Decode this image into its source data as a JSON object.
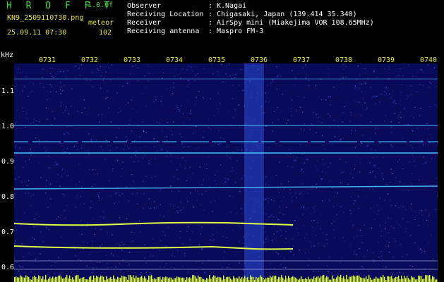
{
  "header": {
    "app_title": "H R O F F T",
    "version": "1.0.0f",
    "file_name": "KN9_2509110730.png",
    "detect_label": "meteor",
    "datetime": "25.09.11 07:30",
    "detect_count": "102"
  },
  "info": [
    {
      "key": "Observer",
      "sep": ":",
      "value": "K.Nagai"
    },
    {
      "key": "Receiving Location",
      "sep": ":",
      "value": "Chigasaki, Japan (139.414 35.340)"
    },
    {
      "key": "Receiver",
      "sep": ":",
      "value": "AirSpy mini (Miakejima VOR 108.65MHz)"
    },
    {
      "key": "Receiving antenna",
      "sep": ":",
      "value": "Maspro FM-3"
    }
  ],
  "chart": {
    "unit_label": "kHz",
    "y_ticks": [
      "1.1",
      "1.0",
      "0.9",
      "0.8",
      "0.7",
      "0.6"
    ],
    "x_ticks": [
      "0731",
      "0732",
      "0733",
      "0734",
      "0735",
      "0736",
      "0737",
      "0738",
      "0739",
      "0740"
    ],
    "colors": {
      "background": "#0a0a5a",
      "trace": "#46c6ff",
      "trace_hot": "#e0ff40",
      "bar": "#e0ff30",
      "echo": "#2d4fe0"
    }
  }
}
